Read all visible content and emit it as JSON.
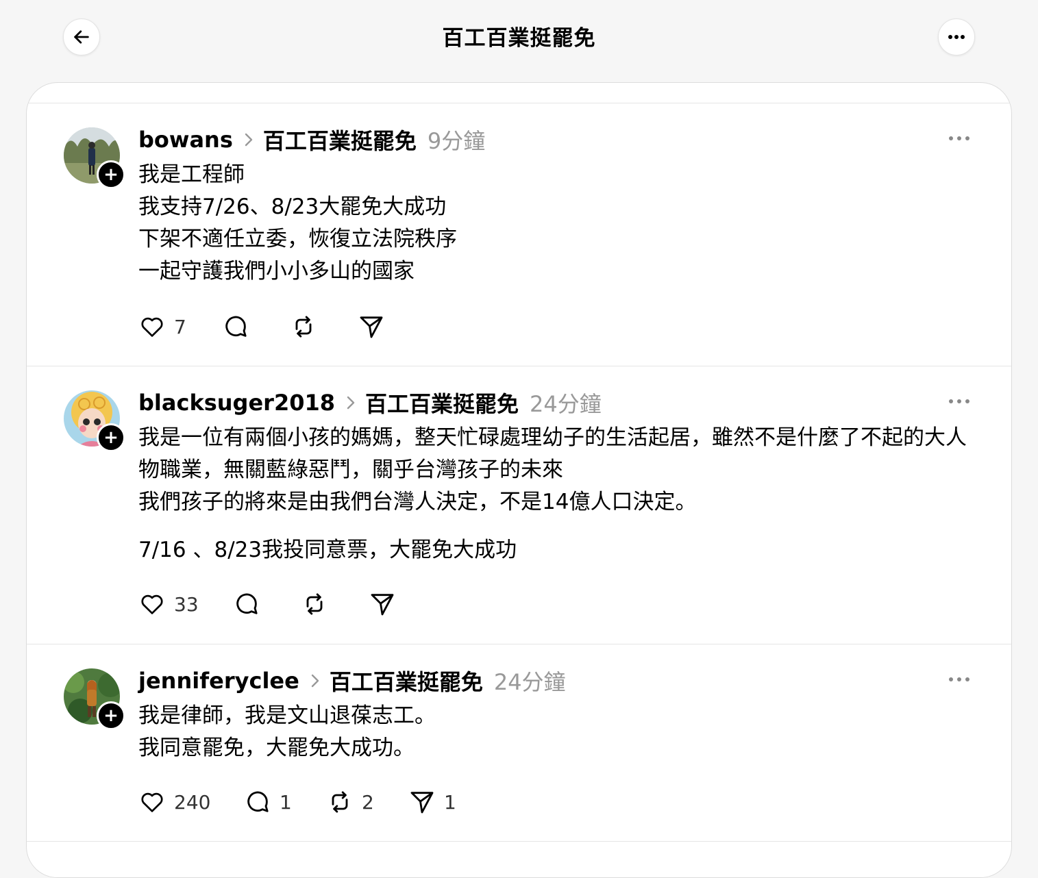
{
  "header": {
    "title": "百工百業挺罷免",
    "back_icon": "arrow-left-icon",
    "more_icon": "ellipsis-icon"
  },
  "posts": [
    {
      "username": "bowans",
      "community": "百工百業挺罷免",
      "time": "9分鐘",
      "paragraphs": [
        "我是工程師\n我支持7/26、8/23大罷免大成功\n下架不適任立委，恢復立法院秩序\n一起守護我們小小多山的國家"
      ],
      "likes": "7",
      "replies": "",
      "reposts": "",
      "shares": ""
    },
    {
      "username": "blacksuger2018",
      "community": "百工百業挺罷免",
      "time": "24分鐘",
      "paragraphs": [
        "我是一位有兩個小孩的媽媽，整天忙碌處理幼子的生活起居，雖然不是什麼了不起的大人物職業，無關藍綠惡鬥，關乎台灣孩子的未來\n我們孩子的將來是由我們台灣人決定，不是14億人口決定。",
        "7/16 、8/23我投同意票，大罷免大成功"
      ],
      "likes": "33",
      "replies": "",
      "reposts": "",
      "shares": ""
    },
    {
      "username": "jenniferyclee",
      "community": "百工百業挺罷免",
      "time": "24分鐘",
      "paragraphs": [
        "我是律師，我是文山退葆志工。\n我同意罷免，大罷免大成功。"
      ],
      "likes": "240",
      "replies": "1",
      "reposts": "2",
      "shares": "1"
    }
  ],
  "colors": {
    "background": "#f6f6f6",
    "card": "#ffffff",
    "muted": "#999999",
    "text": "#000000"
  }
}
